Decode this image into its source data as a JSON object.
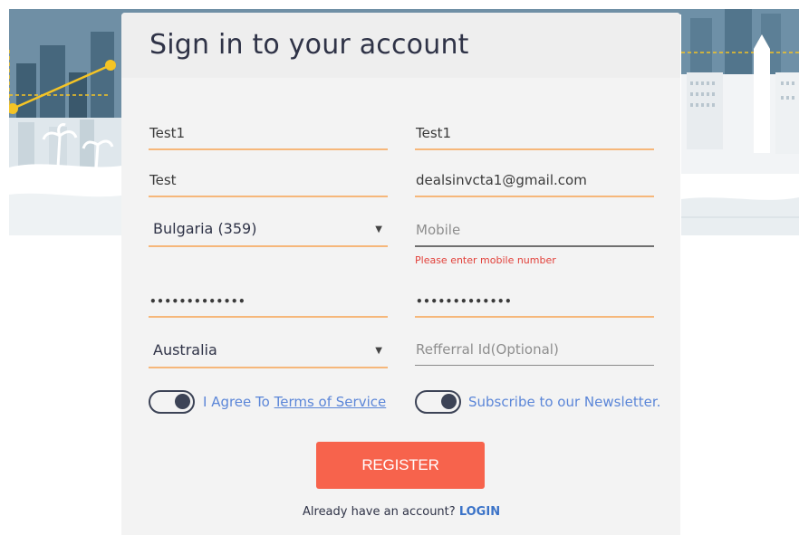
{
  "page": {
    "title": "Sign in to your account"
  },
  "form": {
    "first_name": {
      "value": "Test1"
    },
    "last_name": {
      "value": "Test1"
    },
    "username": {
      "value": "Test"
    },
    "email": {
      "value": "dealsinvcta1@gmail.com"
    },
    "country_code": {
      "value": "Bulgaria (359)"
    },
    "mobile": {
      "placeholder": "Mobile",
      "error": "Please enter mobile number"
    },
    "password": {
      "value": "•••••••••••••"
    },
    "confirm_password": {
      "value": "•••••••••••••"
    },
    "country": {
      "value": "Australia"
    },
    "referral": {
      "placeholder": "Refferral Id(Optional)"
    }
  },
  "toggles": {
    "terms": {
      "prefix": "I Agree To ",
      "link": "Terms of Service",
      "on": true
    },
    "newsletter": {
      "label": "Subscribe to our Newsletter.",
      "on": true
    }
  },
  "actions": {
    "register_label": "REGISTER",
    "already_text": "Already have an account?",
    "login_label": "LOGIN"
  },
  "colors": {
    "accent_underline": "#f6b77a",
    "register_button": "#f7634c",
    "link_blue": "#5b86d8",
    "error_red": "#e2403a",
    "toggle_dark": "#3c4356"
  },
  "icons": {
    "dropdown": "caret-down-icon"
  }
}
